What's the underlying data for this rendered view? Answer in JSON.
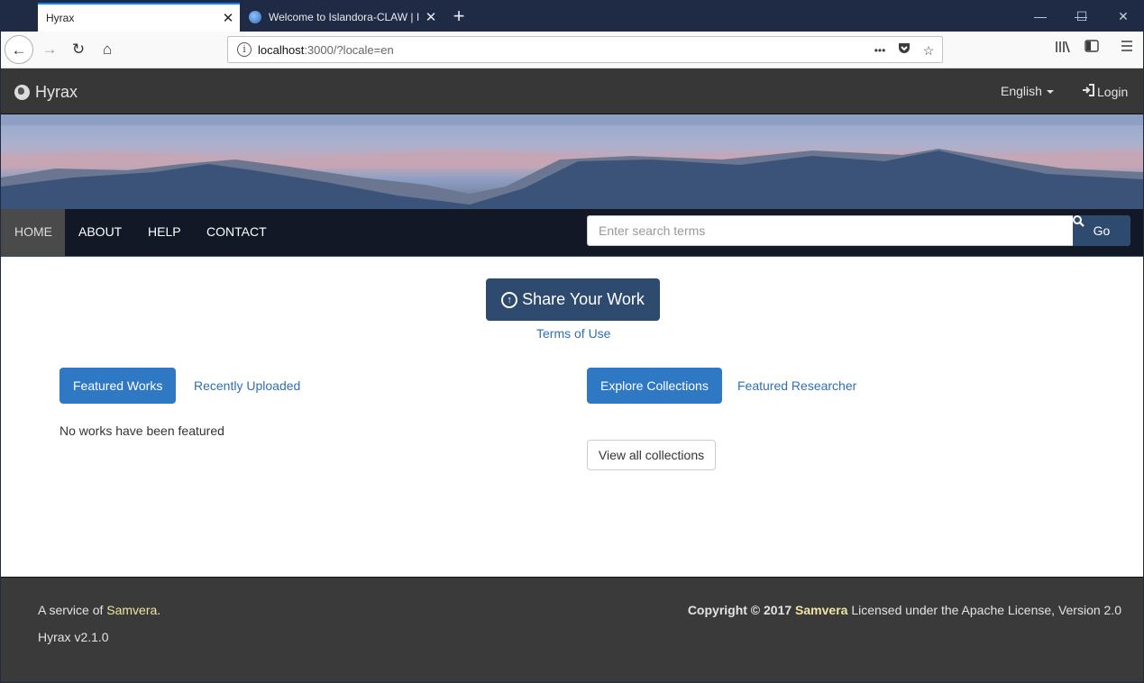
{
  "browser": {
    "tabs": [
      {
        "title": "Hyrax",
        "active": true
      },
      {
        "title": "Welcome to Islandora-CLAW | I",
        "active": false
      }
    ],
    "new_tab": "+",
    "url_host": "localhost",
    "url_rest": ":3000/?locale=en",
    "page_actions": "•••",
    "window_controls": {
      "minimize": "—",
      "maximize": "☐",
      "close": "✕"
    }
  },
  "header": {
    "brand": "Hyrax",
    "language": "English",
    "login": "Login"
  },
  "menu": {
    "items": [
      "HOME",
      "ABOUT",
      "HELP",
      "CONTACT"
    ],
    "active": "HOME"
  },
  "search": {
    "placeholder": "Enter search terms",
    "button": "Go"
  },
  "main": {
    "share_button": "Share Your Work",
    "terms_link": "Terms of Use",
    "left_tabs": [
      "Featured Works",
      "Recently Uploaded"
    ],
    "right_tabs": [
      "Explore Collections",
      "Featured Researcher"
    ],
    "no_works_text": "No works have been featured",
    "view_all_button": "View all collections"
  },
  "footer": {
    "service_prefix": "A service of ",
    "service_link": "Samvera",
    "service_suffix": ".",
    "version": "Hyrax v2.1.0",
    "copyright": "Copyright © 2017",
    "copyright_link": "Samvera",
    "license": " Licensed under the Apache License, Version 2.0"
  },
  "colors": {
    "header_bg": "#373737",
    "primary": "#2e4a6e",
    "tab_active": "#2f78c4",
    "link": "#2f6fb5",
    "footer_link": "#f1e3a2"
  }
}
